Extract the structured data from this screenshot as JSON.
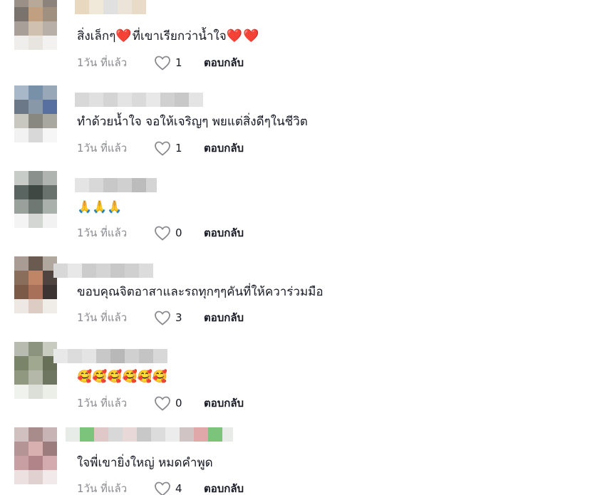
{
  "comments": [
    {
      "text_parts": [
        "สิ่งเล็กๆ",
        "❤️",
        "ที่เขาเรียกว่าน้ำใจ",
        "❤️",
        "❤️"
      ],
      "time": "1วัน ที่แล้ว",
      "likes": "1",
      "reply": "ตอบกลับ"
    },
    {
      "text": "ทำด้วยน้ำใจ จอให้เจริญๆ พยแต่สิ่งดีๆในชีวิต",
      "time": "1วัน ที่แล้ว",
      "likes": "1",
      "reply": "ตอบกลับ"
    },
    {
      "text": "🙏🙏🙏",
      "time": "1วัน ที่แล้ว",
      "likes": "0",
      "reply": "ตอบกลับ"
    },
    {
      "text": "ขอบคุณจิตอาสาและรถทุกๆๆคันที่ให้ควาร่วมมือ",
      "time": "1วัน ที่แล้ว",
      "likes": "3",
      "reply": "ตอบกลับ"
    },
    {
      "text": "🥰🥰🥰🥰🥰🥰",
      "time": "1วัน ที่แล้ว",
      "likes": "0",
      "reply": "ตอบกลับ"
    },
    {
      "text": "ใจพี่เขายิ่งใหญ่ หมดคำพูด",
      "time": "1วัน ที่แล้ว",
      "likes": "4",
      "reply": "ตอบกลับ"
    }
  ],
  "icons": {
    "like": "heart-outline-icon"
  },
  "colors": {
    "text": "#161823",
    "muted": "#8a8b91"
  }
}
